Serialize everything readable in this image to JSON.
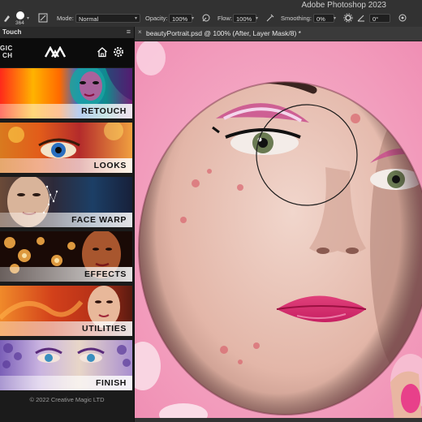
{
  "app": {
    "title": "Adobe Photoshop 2023"
  },
  "options": {
    "brush_size": "364",
    "mode_label": "Mode:",
    "mode_value": "Normal",
    "opacity_label": "Opacity:",
    "opacity_value": "100%",
    "flow_label": "Flow:",
    "flow_value": "100%",
    "smoothing_label": "Smoothing:",
    "smoothing_value": "0%",
    "angle_value": "0°"
  },
  "panel": {
    "tab_title": "Touch",
    "brand_text_line1": "GIC",
    "brand_text_line2": "CH",
    "tiles": [
      {
        "label": "RETOUCH"
      },
      {
        "label": "LOOKS"
      },
      {
        "label": "FACE WARP"
      },
      {
        "label": "EFFECTS"
      },
      {
        "label": "UTILITIES"
      },
      {
        "label": "FINISH"
      }
    ],
    "copyright": "© 2022 Creative Magic LTD"
  },
  "document": {
    "tab_name": "beautyPortrait.psd @ 100% (After, Layer Mask/8) *"
  },
  "colors": {
    "accent_pink": "#f29bbd",
    "panel_bg": "#1b1b1b",
    "chrome_bg": "#323232"
  }
}
